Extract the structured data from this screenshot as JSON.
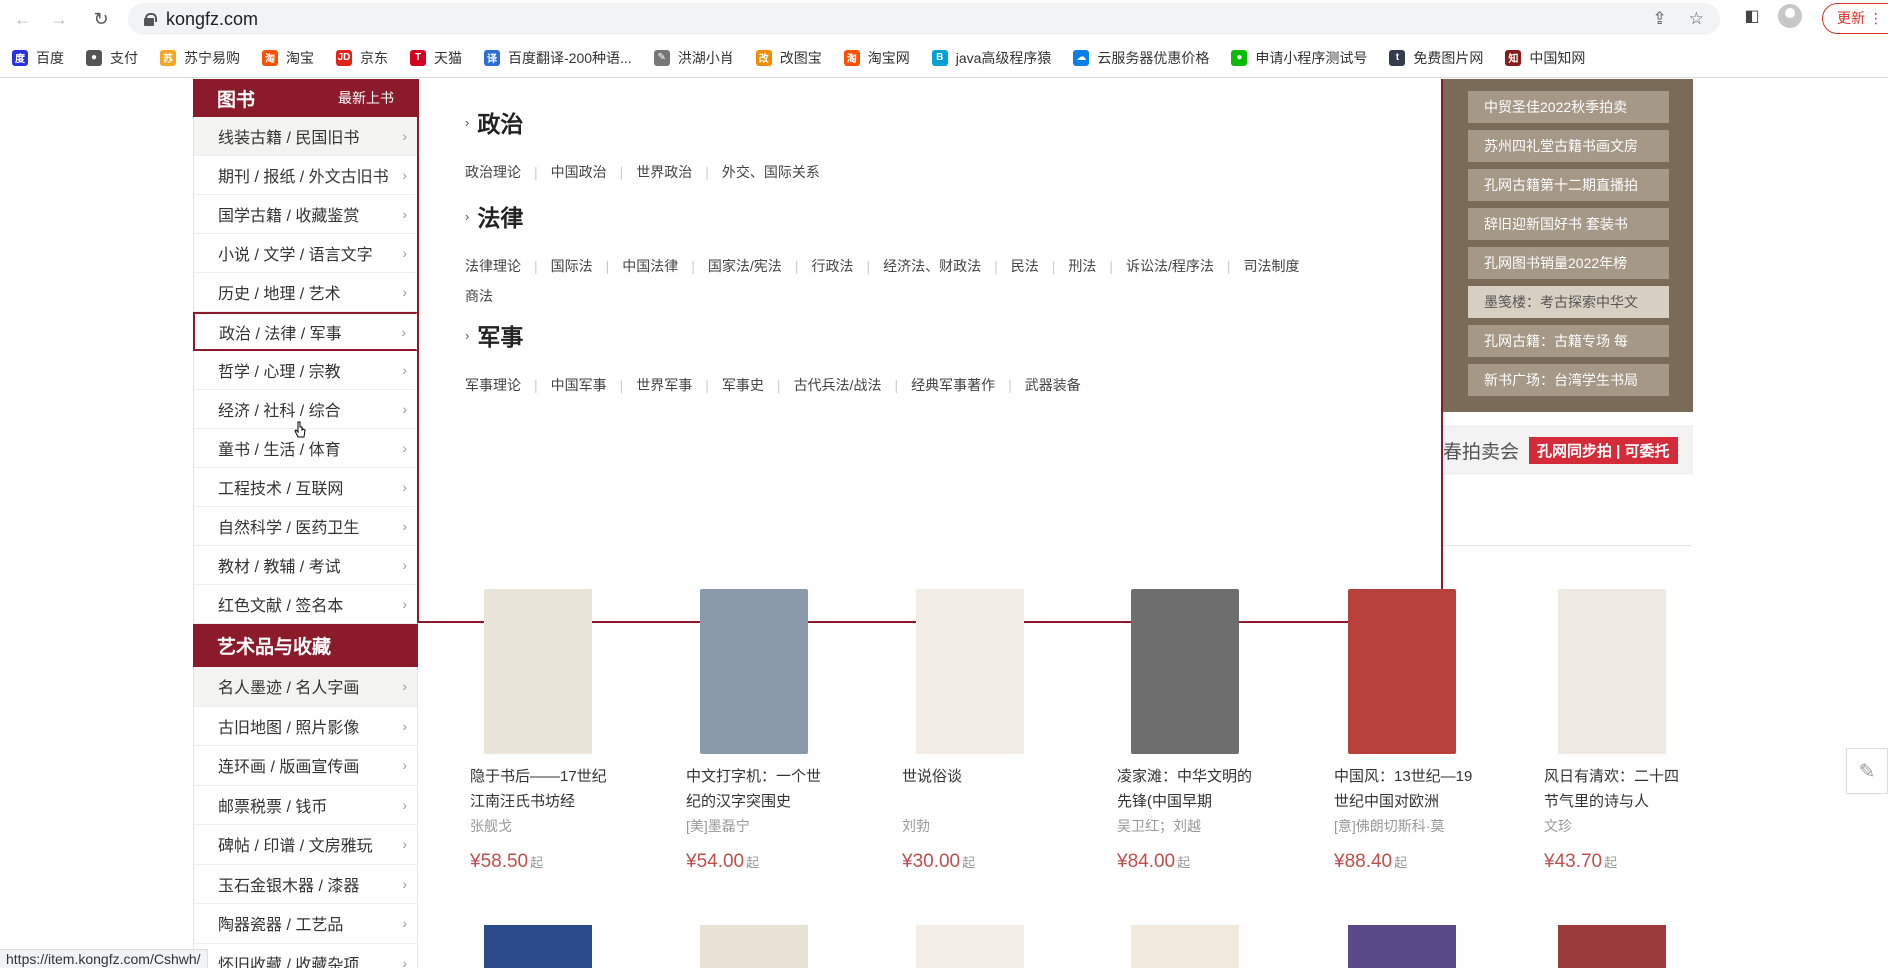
{
  "browser": {
    "back_icon": "←",
    "forward_icon": "→",
    "reload_icon": "↻",
    "url": "kongfz.com",
    "update_label": "更新",
    "status_url": "https://item.kongfz.com/Cshwh/"
  },
  "bookmarks": [
    {
      "label": "百度",
      "color": "#2932e1",
      "glyph": "度"
    },
    {
      "label": "支付",
      "color": "#555555",
      "glyph": "●"
    },
    {
      "label": "苏宁易购",
      "color": "#f5a623",
      "glyph": "苏"
    },
    {
      "label": "淘宝",
      "color": "#ff5000",
      "glyph": "淘"
    },
    {
      "label": "京东",
      "color": "#e1251b",
      "glyph": "JD"
    },
    {
      "label": "天猫",
      "color": "#d4001f",
      "glyph": "T"
    },
    {
      "label": "百度翻译-200种语...",
      "color": "#2b6fd6",
      "glyph": "译"
    },
    {
      "label": "洪湖小肖",
      "color": "#777777",
      "glyph": "✎"
    },
    {
      "label": "改图宝",
      "color": "#f28c00",
      "glyph": "改"
    },
    {
      "label": "淘宝网",
      "color": "#ff5000",
      "glyph": "淘"
    },
    {
      "label": "java高级程序猿",
      "color": "#00a1d6",
      "glyph": "B"
    },
    {
      "label": "云服务器优惠价格",
      "color": "#0a7ee8",
      "glyph": "☁"
    },
    {
      "label": "申请小程序测试号",
      "color": "#09bb07",
      "glyph": "●"
    },
    {
      "label": "免费图片网",
      "color": "#333c4d",
      "glyph": "t"
    },
    {
      "label": "中国知网",
      "color": "#8b1a1a",
      "glyph": "知"
    }
  ],
  "sidebar": {
    "header_title": "图书",
    "header_sub": "最新上书",
    "items": [
      "线装古籍 / 民国旧书",
      "期刊 / 报纸 / 外文古旧书",
      "国学古籍 / 收藏鉴赏",
      "小说 / 文学 / 语言文字",
      "历史 / 地理 / 艺术",
      "政治 / 法律 / 军事",
      "哲学 / 心理 / 宗教",
      "经济 / 社科 / 综合",
      "童书 / 生活 / 体育",
      "工程技术 / 互联网",
      "自然科学 / 医药卫生",
      "教材 / 教辅 / 考试",
      "红色文献 / 签名本"
    ],
    "section2_title": "艺术品与收藏",
    "section2_items": [
      "名人墨迹 / 名人字画",
      "古旧地图 / 照片影像",
      "连环画 / 版画宣传画",
      "邮票税票 / 钱币",
      "碑帖 / 印谱 / 文房雅玩",
      "玉石金银木器 / 漆器",
      "陶器瓷器 / 工艺品",
      "怀旧收藏 / 收藏杂项"
    ]
  },
  "flyout": {
    "categories": [
      {
        "title": "政治",
        "links": [
          "政治理论",
          "中国政治",
          "世界政治",
          "外交、国际关系"
        ]
      },
      {
        "title": "法律",
        "links": [
          "法律理论",
          "国际法",
          "中国法律",
          "国家法/宪法",
          "行政法",
          "经济法、财政法",
          "民法",
          "刑法",
          "诉讼法/程序法",
          "司法制度",
          "商法"
        ]
      },
      {
        "title": "军事",
        "links": [
          "军事理论",
          "中国军事",
          "世界军事",
          "军事史",
          "古代兵法/战法",
          "经典军事著作",
          "武器装备"
        ]
      }
    ]
  },
  "banner": {
    "items": [
      "中贸圣佳2022秋季拍卖",
      "苏州四礼堂古籍书画文房",
      "孔网古籍第十二期直播拍",
      "辞旧迎新国好书 套装书",
      "孔网图书销量2022年榜",
      "墨笺楼：考古探索中华文",
      "孔网古籍：古籍专场 每",
      "新书广场：台湾学生书局"
    ],
    "auction_text": "春拍卖会",
    "auction_tag": "孔网同步拍 | 可委托"
  },
  "books": [
    {
      "title": "隐于书后——17世纪江南汪氏书坊经",
      "author": "张舰戈",
      "price": "¥58.50",
      "suffix": "起",
      "cover": "#e9e4da"
    },
    {
      "title": "中文打字机：一个世纪的汉字突围史",
      "author": "[美]墨磊宁",
      "price": "¥54.00",
      "suffix": "起",
      "cover": "#8a9aab"
    },
    {
      "title": "世说俗谈",
      "author": "刘勃",
      "price": "¥30.00",
      "suffix": "起",
      "cover": "#f1ece4"
    },
    {
      "title": "凌家滩：中华文明的先锋(中国早期",
      "author": "吴卫红；刘越",
      "price": "¥84.00",
      "suffix": "起",
      "cover": "#6e6e6e"
    },
    {
      "title": "中国风：13世纪—19世纪中国对欧洲",
      "author": "[意]佛朗切斯科·莫",
      "price": "¥88.40",
      "suffix": "起",
      "cover": "#b8403a"
    },
    {
      "title": "风日有清欢：二十四节气里的诗与人",
      "author": "文珍",
      "price": "¥43.70",
      "suffix": "起",
      "cover": "#eeeae2"
    }
  ],
  "second_row_colors": [
    "#2a4a8a",
    "#e8e2d4",
    "#f3efe8",
    "#f0e9dc",
    "#5a4a8a",
    "#9a3a3a"
  ],
  "edit_icon": "✎"
}
